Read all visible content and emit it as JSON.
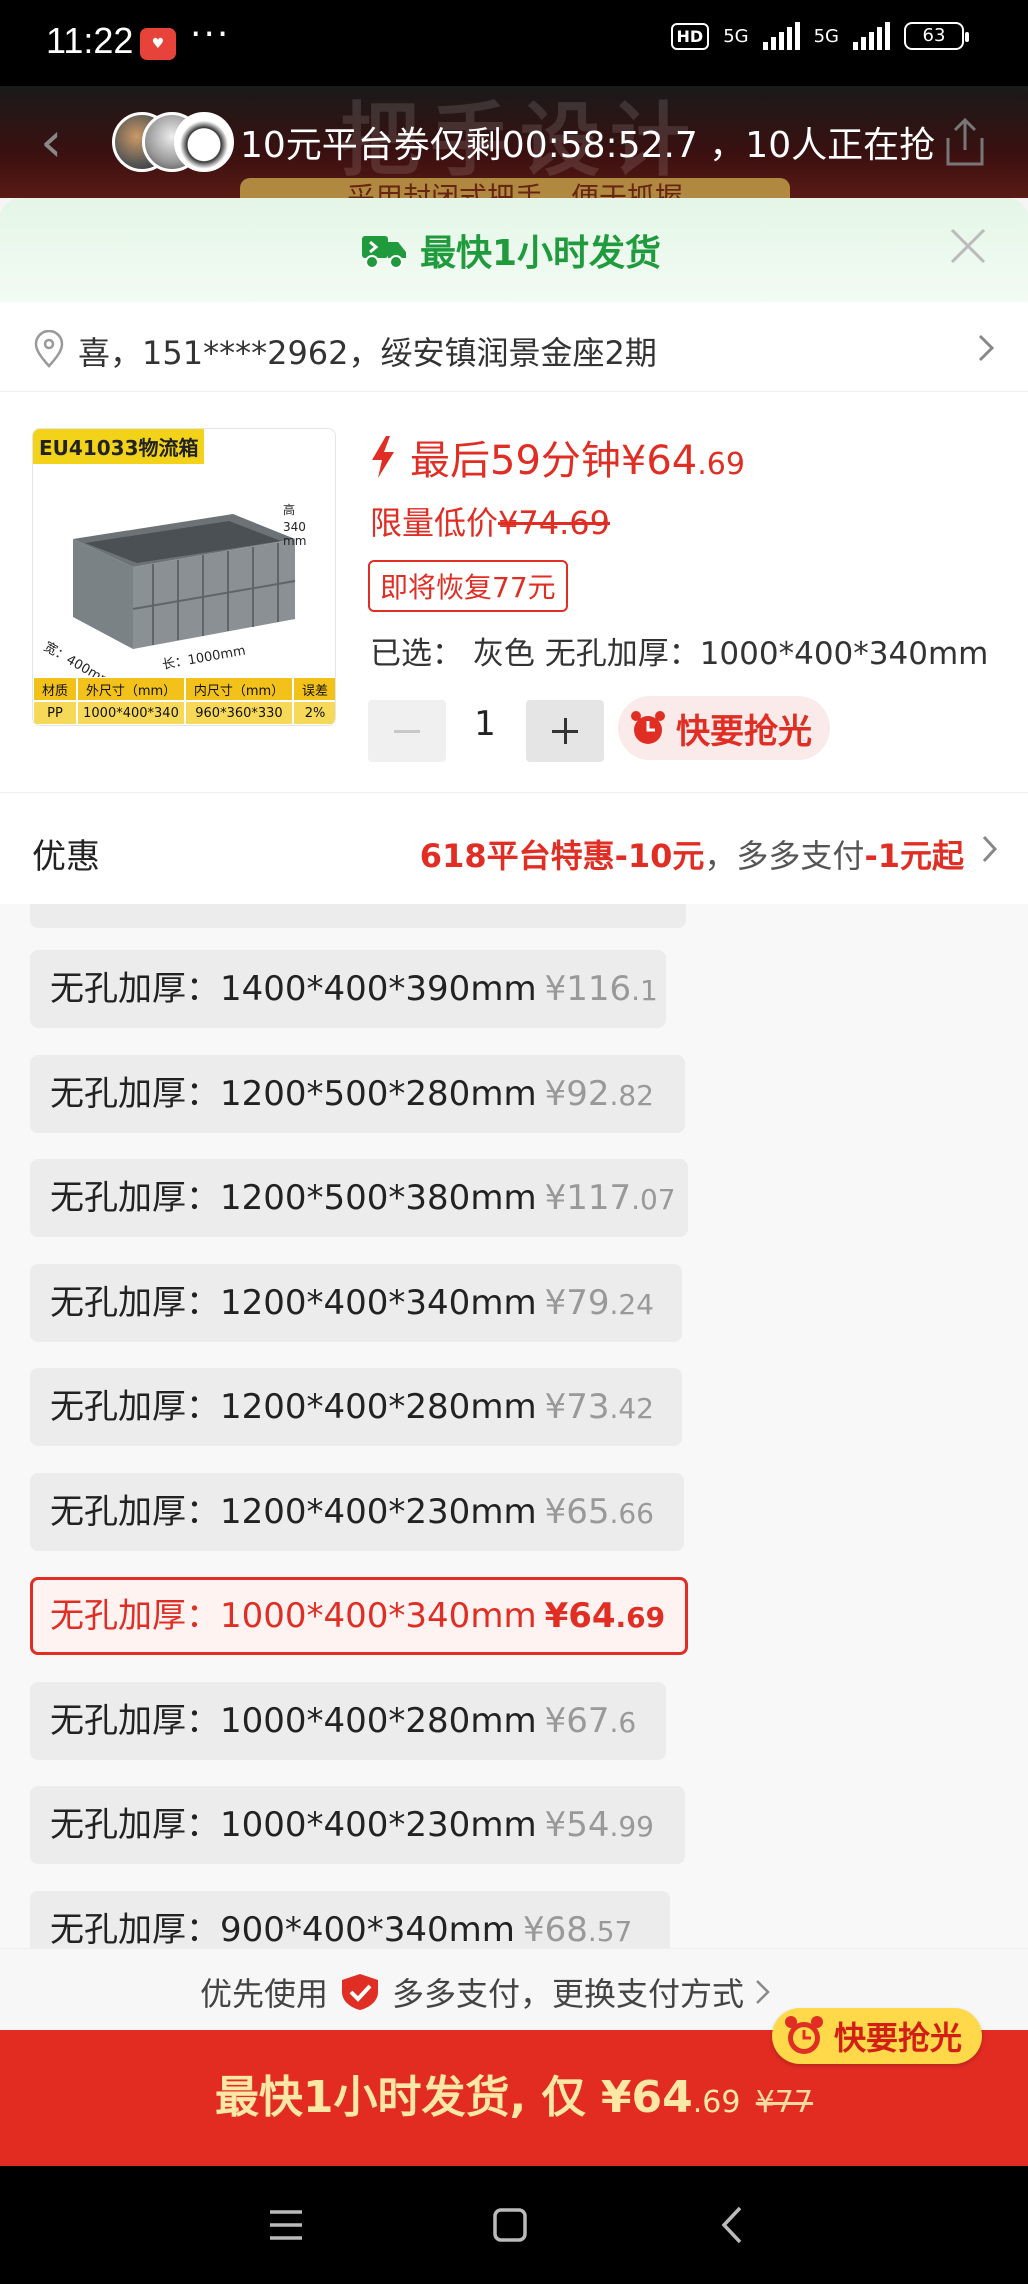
{
  "status_bar": {
    "time": "11:22",
    "dots": "···",
    "hd": "HD",
    "network1": "5G",
    "network2": "5G",
    "battery": "63"
  },
  "top_banner": {
    "watermark": "把手设计",
    "subtitle": "采用封闭式把手，便于抓握",
    "countdown_text": "10元平台券仅剩00:58:52.7 ，10人正在抢"
  },
  "delivery": {
    "text": "最快1小时发货",
    "color": "#1f9a3c"
  },
  "address": {
    "text": "喜，151****2962，绥安镇润景金座2期"
  },
  "product": {
    "image_tag": "EU41033物流箱",
    "image_table": {
      "headers": [
        "材质",
        "外尺寸（mm）",
        "内尺寸（mm）",
        "误差"
      ],
      "values": [
        "PP",
        "1000*400*340",
        "960*360*330",
        "2%"
      ]
    },
    "flash_prefix": "最后59分钟¥64",
    "flash_suffix": ".69",
    "limit_label": "限量低价",
    "limit_old_price": "¥74.69",
    "restore_text": "即将恢复77元",
    "selected_text": "已选：  灰色 无孔加厚：1000*400*340mm",
    "quantity": "1",
    "hurry_text": "快要抢光",
    "accent_color": "#e02e24"
  },
  "discount": {
    "label": "优惠",
    "part1": "618平台特惠-10元",
    "part2": "，多多支付",
    "part3": "-1元起"
  },
  "skus": [
    {
      "label": "无孔加厚：1400*400*390mm",
      "price_main": "¥116",
      "price_frac": ".1",
      "selected": false
    },
    {
      "label": "无孔加厚：1200*500*280mm",
      "price_main": "¥92",
      "price_frac": ".82",
      "selected": false
    },
    {
      "label": "无孔加厚：1200*500*380mm",
      "price_main": "¥117",
      "price_frac": ".07",
      "selected": false
    },
    {
      "label": "无孔加厚：1200*400*340mm",
      "price_main": "¥79",
      "price_frac": ".24",
      "selected": false
    },
    {
      "label": "无孔加厚：1200*400*280mm",
      "price_main": "¥73",
      "price_frac": ".42",
      "selected": false
    },
    {
      "label": "无孔加厚：1200*400*230mm",
      "price_main": "¥65",
      "price_frac": ".66",
      "selected": false
    },
    {
      "label": "无孔加厚：1000*400*340mm",
      "price_main": "¥64",
      "price_frac": ".69",
      "selected": true
    },
    {
      "label": "无孔加厚：1000*400*280mm",
      "price_main": "¥67",
      "price_frac": ".6",
      "selected": false
    },
    {
      "label": "无孔加厚：1000*400*230mm",
      "price_main": "¥54",
      "price_frac": ".99",
      "selected": false
    },
    {
      "label": "无孔加厚：900*400*340mm",
      "price_main": "¥68",
      "price_frac": ".57",
      "selected": false
    }
  ],
  "pay_strip": {
    "prefix": "优先使用",
    "suffix": "多多支付，更换支付方式"
  },
  "cta": {
    "main": "最快1小时发货, 仅 ¥64",
    "frac": ".69",
    "old_price": "¥77",
    "badge": "快要抢光",
    "color": "#e22c22"
  },
  "navbar": {
    "icons": [
      "menu-icon",
      "home-icon",
      "back-icon"
    ]
  }
}
